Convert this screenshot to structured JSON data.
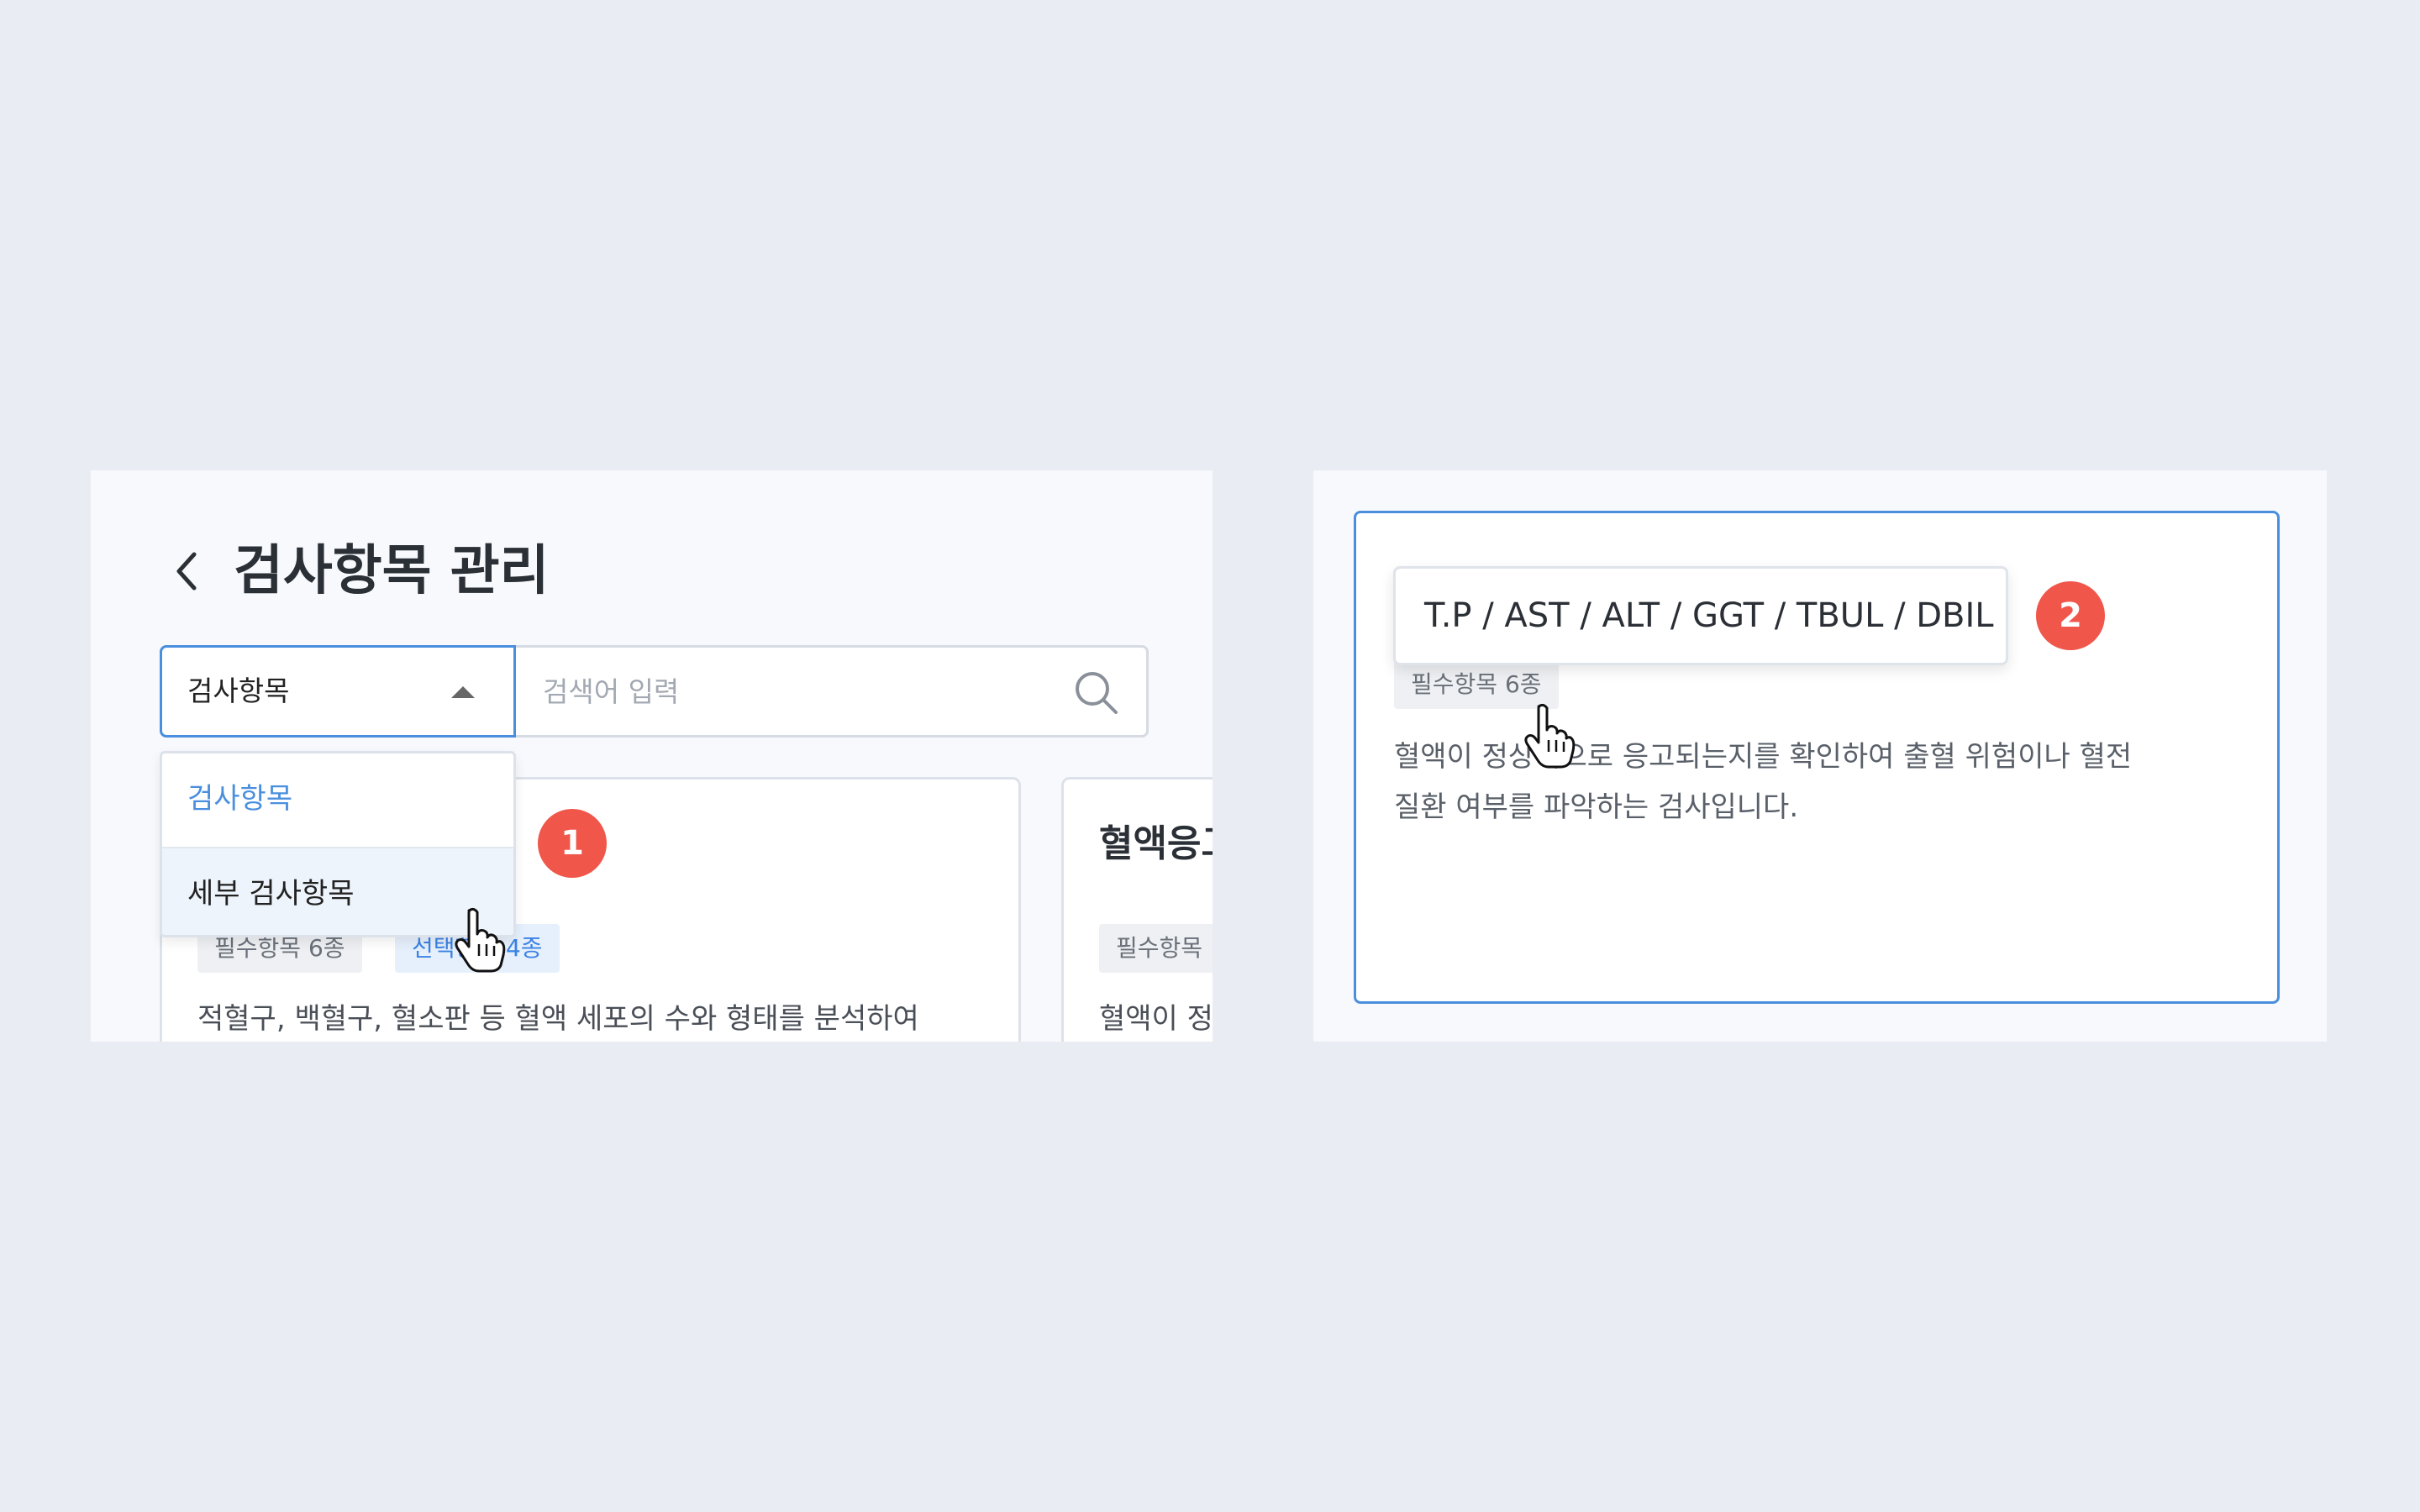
{
  "header": {
    "title": "검사항목 관리"
  },
  "search": {
    "category_value": "검사항목",
    "placeholder": "검색어 입력"
  },
  "dropdown": {
    "options": [
      "검사항목",
      "세부 검사항목"
    ],
    "selected_index": 0,
    "hovered_index": 1
  },
  "cards": [
    {
      "title": "",
      "required_tag": "필수항목 6종",
      "optional_tag": "선택항목 4종",
      "description": "적혈구, 백혈구, 혈소판 등 혈액 세포의 수와 형태를 분석하여"
    },
    {
      "title": "혈액응고",
      "required_tag": "필수항목",
      "description": "혈액이 정"
    }
  ],
  "detail": {
    "tooltip_text": "T.P / AST / ALT / GGT / TBUL / DBIL",
    "required_tag": "필수항목 6종",
    "description_line1": "혈액이 정상적으로 응고되는지를 확인하여 출혈 위험이나 혈전",
    "description_line2": "질환 여부를 파악하는 검사입니다."
  },
  "steps": [
    "1",
    "2"
  ],
  "colors": {
    "accent": "#4a8fde",
    "badge": "#f0564a",
    "background": "#e9ecf2",
    "panel": "#f7f9fc"
  }
}
